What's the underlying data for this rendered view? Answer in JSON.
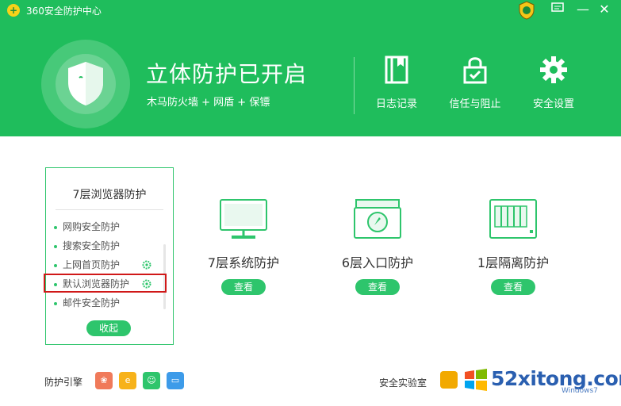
{
  "window": {
    "app_title": "360安全防护中心",
    "buttons": {
      "feedback": "feedback-icon",
      "minimize": "—",
      "close": "✕"
    }
  },
  "header": {
    "main_title": "立体防护已开启",
    "subtitle": "木马防火墙 + 网盾 + 保镖",
    "tools": [
      {
        "label": "日志记录",
        "icon": "log-book-icon"
      },
      {
        "label": "信任与阻止",
        "icon": "lock-trust-icon"
      },
      {
        "label": "安全设置",
        "icon": "gear-icon"
      }
    ]
  },
  "browser_card": {
    "title": "7层浏览器防护",
    "items": [
      {
        "label": "网购安全防护",
        "has_settings": false
      },
      {
        "label": "搜索安全防护",
        "has_settings": false
      },
      {
        "label": "上网首页防护",
        "has_settings": true
      },
      {
        "label": "默认浏览器防护",
        "has_settings": true,
        "highlighted": true
      },
      {
        "label": "邮件安全防护",
        "has_settings": false
      }
    ],
    "collapse_label": "收起"
  },
  "layers": [
    {
      "name": "7层系统防护",
      "button": "查看",
      "icon": "monitor-icon"
    },
    {
      "name": "6层入口防护",
      "button": "查看",
      "icon": "entry-compass-icon"
    },
    {
      "name": "1层隔离防护",
      "button": "查看",
      "icon": "isolation-icon"
    }
  ],
  "footer": {
    "engine_label": "防护引擎",
    "engines": [
      {
        "icon": "leaf-engine-icon",
        "color": "#f07a5a"
      },
      {
        "icon": "e-engine-icon",
        "color": "#f7b21a"
      },
      {
        "icon": "user-engine-icon",
        "color": "#2ec56c"
      },
      {
        "icon": "box-engine-icon",
        "color": "#3d9be9"
      }
    ],
    "lab_label": "安全实验室"
  },
  "watermark": {
    "text": "52xitong.com",
    "sub": "Windows7"
  },
  "colors": {
    "brand_green": "#1fbd5c",
    "accent_green": "#2ec56c",
    "highlight_red": "#d01818"
  }
}
